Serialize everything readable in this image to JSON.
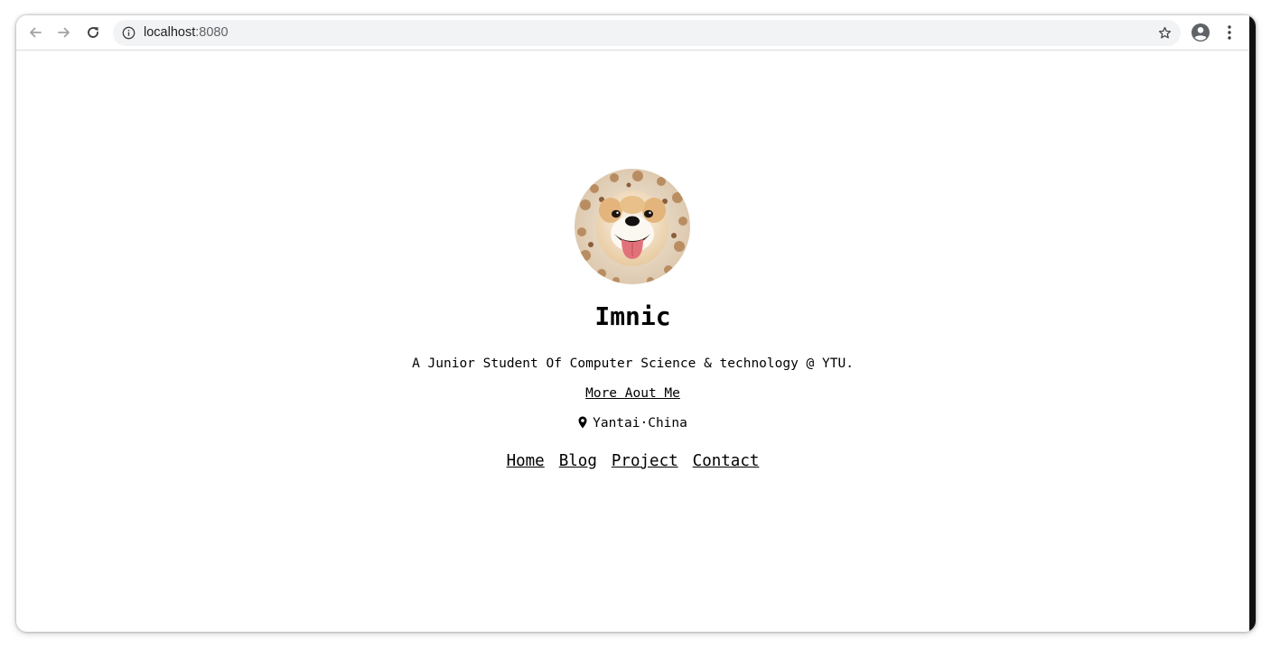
{
  "browser": {
    "url_host": "localhost",
    "url_port": ":8080",
    "icons": {
      "back": "arrow-left-icon",
      "forward": "arrow-right-icon",
      "reload": "reload-icon",
      "site_info": "info-icon",
      "bookmark": "star-icon",
      "profile": "account-circle-icon",
      "menu": "kebab-menu-icon"
    }
  },
  "profile": {
    "avatar": "shiba-inu-dog-photo",
    "name": "Imnic",
    "bio": "A Junior Student Of Computer Science & technology @ YTU.",
    "more_link": "More Aout Me",
    "location": "Yantai·China",
    "location_icon": "map-pin-icon"
  },
  "nav": {
    "links": [
      "Home",
      "Blog",
      "Project",
      "Contact"
    ]
  },
  "colors": {
    "text": "#000000",
    "omnibox_bg": "#f1f3f4",
    "toolbar_icon": "#5f6368"
  }
}
